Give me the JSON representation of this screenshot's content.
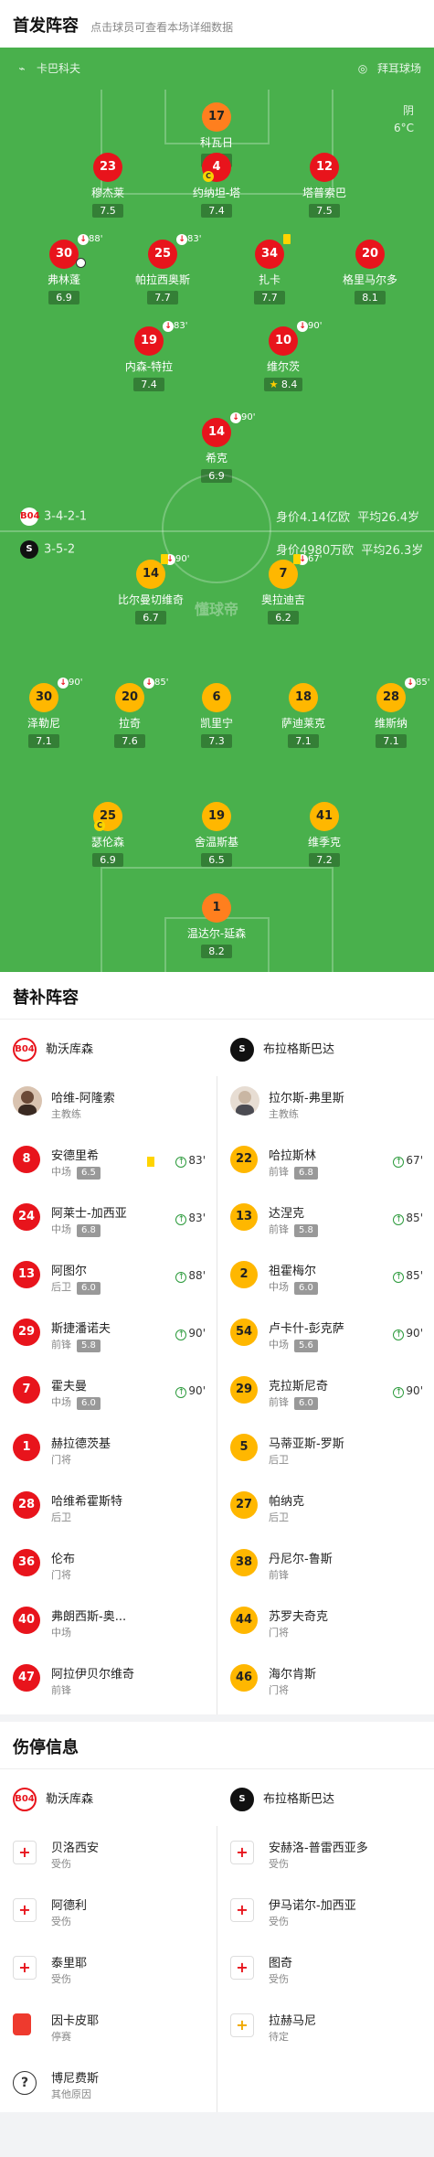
{
  "header": {
    "title": "首发阵容",
    "subtitle": "点击球员可查看本场详细数据"
  },
  "venue": {
    "home": "卡巴科夫",
    "away": "拜耳球场",
    "home_icon": "whistle-icon",
    "away_icon": "stadium-icon"
  },
  "weather": {
    "condition": "阴",
    "temp": "6°C"
  },
  "home_team": {
    "name": "勒沃库森",
    "formation": "3-4-2-1",
    "value": "身价4.14亿欧",
    "age": "平均26.4岁"
  },
  "away_team": {
    "name": "布拉格斯巴达",
    "formation": "3-5-2",
    "value": "身价4980万欧",
    "age": "平均26.3岁"
  },
  "center_logo": "懂球帝",
  "players": [
    {
      "n": "17",
      "name": "科瓦日",
      "r": "6.8",
      "c": "orange"
    },
    {
      "n": "23",
      "name": "穆杰莱",
      "r": "7.5",
      "c": "red"
    },
    {
      "n": "4",
      "name": "约纳坦-塔",
      "r": "7.4",
      "c": "red"
    },
    {
      "n": "12",
      "name": "塔普索巴",
      "r": "7.5",
      "c": "red"
    },
    {
      "n": "30",
      "name": "弗林蓬",
      "r": "6.9",
      "c": "red",
      "m": "88'"
    },
    {
      "n": "25",
      "name": "帕拉西奥斯",
      "r": "7.7",
      "c": "red",
      "m": "83'"
    },
    {
      "n": "34",
      "name": "扎卡",
      "r": "7.7",
      "c": "red"
    },
    {
      "n": "20",
      "name": "格里马尔多",
      "r": "8.1",
      "c": "red"
    },
    {
      "n": "19",
      "name": "内森-特拉",
      "r": "7.4",
      "c": "red",
      "m": "83'"
    },
    {
      "n": "10",
      "name": "维尔茨",
      "r": "8.4",
      "c": "red",
      "m": "90'"
    },
    {
      "n": "14",
      "name": "希克",
      "r": "6.9",
      "c": "red",
      "m": "90'"
    },
    {
      "n": "14",
      "name": "比尔曼切维奇",
      "r": "6.7",
      "c": "yellow",
      "m": "90'"
    },
    {
      "n": "7",
      "name": "奥拉迪吉",
      "r": "6.2",
      "c": "yellow",
      "m": "67'"
    },
    {
      "n": "30",
      "name": "泽勒尼",
      "r": "7.1",
      "c": "yellow",
      "m": "90'"
    },
    {
      "n": "20",
      "name": "拉奇",
      "r": "7.6",
      "c": "yellow",
      "m": "85'"
    },
    {
      "n": "6",
      "name": "凯里宁",
      "r": "7.3",
      "c": "yellow"
    },
    {
      "n": "18",
      "name": "萨迪莱克",
      "r": "7.1",
      "c": "yellow"
    },
    {
      "n": "28",
      "name": "维斯纳",
      "r": "7.1",
      "c": "yellow",
      "m": "85'"
    },
    {
      "n": "25",
      "name": "瑟伦森",
      "r": "6.9",
      "c": "yellow"
    },
    {
      "n": "19",
      "name": "舍温斯基",
      "r": "6.5",
      "c": "yellow"
    },
    {
      "n": "41",
      "name": "维季克",
      "r": "7.2",
      "c": "yellow"
    },
    {
      "n": "1",
      "name": "温达尔-延森",
      "r": "8.2",
      "c": "orange"
    }
  ],
  "subs": {
    "title": "替补阵容",
    "home_coach": {
      "name": "哈维-阿隆索",
      "role": "主教练"
    },
    "away_coach": {
      "name": "拉尔斯-弗里斯",
      "role": "主教练"
    },
    "home": [
      {
        "n": "8",
        "name": "安德里希",
        "pos": "中场",
        "r": "6.5",
        "in": "83'"
      },
      {
        "n": "24",
        "name": "阿莱士-加西亚",
        "pos": "中场",
        "r": "6.8",
        "in": "83'"
      },
      {
        "n": "13",
        "name": "阿图尔",
        "pos": "后卫",
        "r": "6.0",
        "in": "88'"
      },
      {
        "n": "29",
        "name": "斯捷潘诺夫",
        "pos": "前锋",
        "r": "5.8",
        "in": "90'"
      },
      {
        "n": "7",
        "name": "霍夫曼",
        "pos": "中场",
        "r": "6.0",
        "in": "90'"
      },
      {
        "n": "1",
        "name": "赫拉德茨基",
        "pos": "门将"
      },
      {
        "n": "28",
        "name": "哈维希霍斯特",
        "pos": "后卫"
      },
      {
        "n": "36",
        "name": "伦布",
        "pos": "门将"
      },
      {
        "n": "40",
        "name": "弗朗西斯-奥...",
        "pos": "中场"
      },
      {
        "n": "47",
        "name": "阿拉伊贝尔维奇",
        "pos": "前锋"
      }
    ],
    "away": [
      {
        "n": "22",
        "name": "哈拉斯林",
        "pos": "前锋",
        "r": "6.8",
        "in": "67'"
      },
      {
        "n": "13",
        "name": "达涅克",
        "pos": "前锋",
        "r": "5.8",
        "in": "85'"
      },
      {
        "n": "2",
        "name": "祖霍梅尔",
        "pos": "中场",
        "r": "6.0",
        "in": "85'"
      },
      {
        "n": "54",
        "name": "卢卡什-彭克萨",
        "pos": "中场",
        "r": "5.6",
        "in": "90'"
      },
      {
        "n": "29",
        "name": "克拉斯尼奇",
        "pos": "前锋",
        "r": "6.0",
        "in": "90'"
      },
      {
        "n": "5",
        "name": "马蒂亚斯-罗斯",
        "pos": "后卫"
      },
      {
        "n": "27",
        "name": "帕纳克",
        "pos": "后卫"
      },
      {
        "n": "38",
        "name": "丹尼尔-鲁斯",
        "pos": "前锋"
      },
      {
        "n": "44",
        "name": "苏罗夫奇克",
        "pos": "门将"
      },
      {
        "n": "46",
        "name": "海尔肯斯",
        "pos": "门将"
      }
    ]
  },
  "injury": {
    "title": "伤停信息",
    "home": [
      {
        "name": "贝洛西安",
        "status": "受伤",
        "icon": "medical-kit-icon"
      },
      {
        "name": "阿德利",
        "status": "受伤",
        "icon": "medical-kit-icon"
      },
      {
        "name": "泰里耶",
        "status": "受伤",
        "icon": "medical-kit-icon"
      },
      {
        "name": "因卡皮耶",
        "status": "停赛",
        "icon": "red-card-icon"
      },
      {
        "name": "博尼费斯",
        "status": "其他原因",
        "icon": "question-icon"
      }
    ],
    "away": [
      {
        "name": "安赫洛-普雷西亚多",
        "status": "受伤",
        "icon": "medical-kit-icon"
      },
      {
        "name": "伊马诺尔-加西亚",
        "status": "受伤",
        "icon": "medical-kit-icon"
      },
      {
        "name": "图奇",
        "status": "受伤",
        "icon": "medical-kit-icon"
      },
      {
        "name": "拉赫马尼",
        "status": "待定",
        "icon": "doubtful-icon"
      }
    ]
  }
}
